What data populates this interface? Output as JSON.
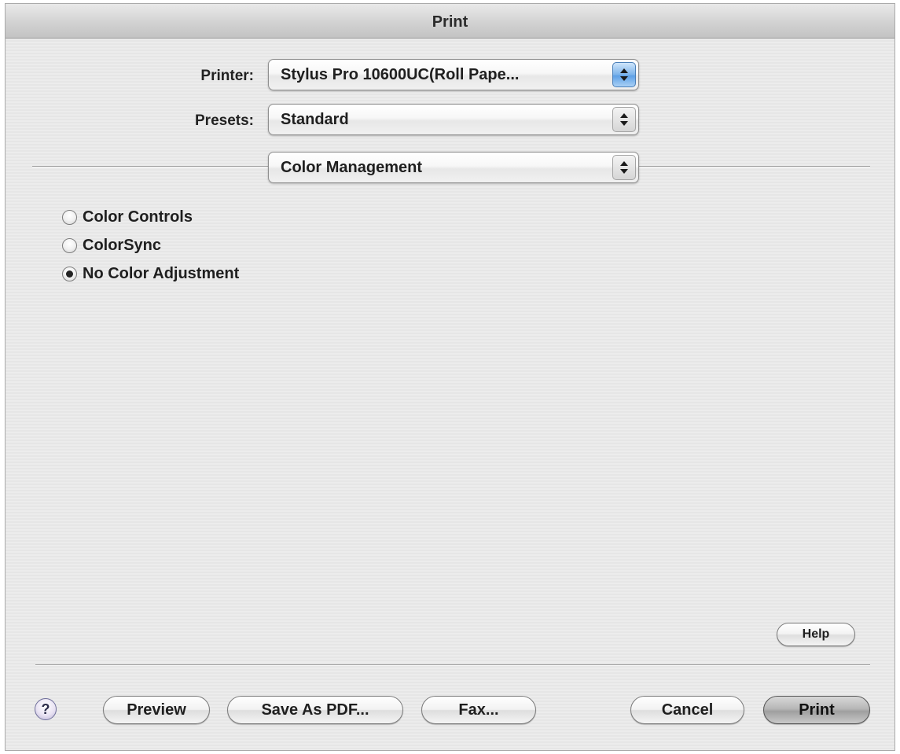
{
  "window": {
    "title": "Print"
  },
  "printer": {
    "label": "Printer:",
    "value": "Stylus Pro 10600UC(Roll Pape..."
  },
  "presets": {
    "label": "Presets:",
    "value": "Standard"
  },
  "panel": {
    "value": "Color Management"
  },
  "color_options": [
    {
      "label": "Color Controls",
      "checked": false
    },
    {
      "label": "ColorSync",
      "checked": false
    },
    {
      "label": "No Color Adjustment",
      "checked": true
    }
  ],
  "help_button": {
    "label": "Help"
  },
  "footer": {
    "help_icon": "?",
    "preview_label": "Preview",
    "save_pdf_label": "Save As PDF...",
    "fax_label": "Fax...",
    "cancel_label": "Cancel",
    "print_label": "Print"
  }
}
